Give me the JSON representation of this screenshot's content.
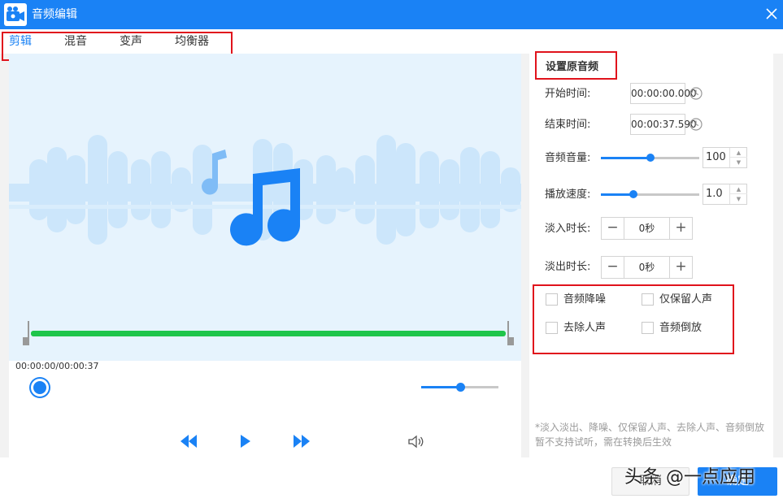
{
  "window": {
    "title": "音频编辑",
    "close_glyph": "✕"
  },
  "tabs": [
    {
      "label": "剪辑",
      "active": true
    },
    {
      "label": "混音",
      "active": false
    },
    {
      "label": "变声",
      "active": false
    },
    {
      "label": "均衡器",
      "active": false
    }
  ],
  "player": {
    "time_display": "00:00:00/00:00:37",
    "trim_start_fraction": 0,
    "trim_end_fraction": 1,
    "volume_fraction": 0.5
  },
  "settings": {
    "title": "设置原音频",
    "start_time": {
      "label": "开始时间:",
      "value": "00:00:00.000"
    },
    "end_time": {
      "label": "结束时间:",
      "value": "00:00:37.590"
    },
    "volume": {
      "label": "音频音量:",
      "value": "100",
      "fraction": 0.5
    },
    "speed": {
      "label": "播放速度:",
      "value": "1.0",
      "fraction": 0.33
    },
    "fade_in": {
      "label": "淡入时长:",
      "value": "0秒"
    },
    "fade_out": {
      "label": "淡出时长:",
      "value": "0秒"
    },
    "options": [
      {
        "label": "音频降噪",
        "checked": false
      },
      {
        "label": "仅保留人声",
        "checked": false
      },
      {
        "label": "去除人声",
        "checked": false
      },
      {
        "label": "音频倒放",
        "checked": false
      }
    ],
    "note": "*淡入淡出、降噪、仅保留人声、去除人声、音频倒放暂不支持试听，需在转换后生效"
  },
  "footer": {
    "secondary_label": "取消",
    "primary_label": "确定"
  },
  "watermark": "头条 @一点应用",
  "colors": {
    "accent": "#1a82f5",
    "track": "#1fc54a",
    "highlight": "#e0131c",
    "preview_bg": "#e6f3fd"
  },
  "icons": [
    "app-icon",
    "close-icon",
    "music-note-icon",
    "rewind-icon",
    "play-icon",
    "fast-forward-icon",
    "volume-icon",
    "clock-icon"
  ]
}
